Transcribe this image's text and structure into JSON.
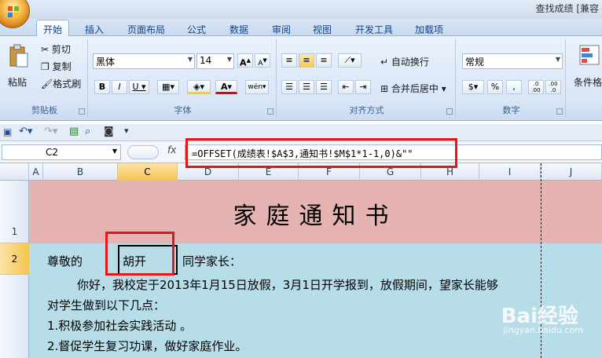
{
  "window": {
    "title": "查找成绩 [兼容"
  },
  "tabs": [
    "开始",
    "插入",
    "页面布局",
    "公式",
    "数据",
    "审阅",
    "视图",
    "开发工具",
    "加载项"
  ],
  "ribbon": {
    "clipboard": {
      "paste": "粘贴",
      "cut": "剪切",
      "copy": "复制",
      "format_painter": "格式刷",
      "label": "剪贴板"
    },
    "font": {
      "name": "黑体",
      "size": "14",
      "bold": "B",
      "italic": "I",
      "underline": "U",
      "label": "字体",
      "grow": "A",
      "shrink": "A",
      "font_color": "A",
      "phonetic": "wén"
    },
    "alignment": {
      "wrap": "自动换行",
      "merge": "合并后居中",
      "label": "对齐方式"
    },
    "number": {
      "format": "常规",
      "percent": "%",
      "comma": ",",
      "label": "数字",
      "inc": ".0 .00",
      "dec": ".00 .0"
    },
    "styles": {
      "cond": "条件格式"
    }
  },
  "formula_bar": {
    "name_box": "C2",
    "fx": "fx",
    "formula": "=OFFSET(成绩表!$A$3,通知书!$M$1*1-1,0)&\"\""
  },
  "columns": [
    "A",
    "B",
    "C",
    "D",
    "E",
    "F",
    "G",
    "H",
    "I",
    "J"
  ],
  "rows": [
    "1",
    "2"
  ],
  "sheet": {
    "title": "家庭通知书",
    "greeting_prefix": "尊敬的",
    "student_name": "胡开",
    "greeting_suffix": "同学家长：",
    "line1": "你好，我校定于2013年1月15日放假，3月1日开学报到，放假期间，望家长能够",
    "line2": "对学生做到以下几点：",
    "line3": "1.积极参加社会实践活动 。",
    "line4": "2.督促学生复习功课，做好家庭作业。"
  },
  "watermark": {
    "brand": "Bai经验",
    "url": "jingyan.baidu.com"
  },
  "colors": {
    "title_row": "#e6b3b3",
    "body_fill": "#b7dde8",
    "highlight": "#e01818"
  }
}
